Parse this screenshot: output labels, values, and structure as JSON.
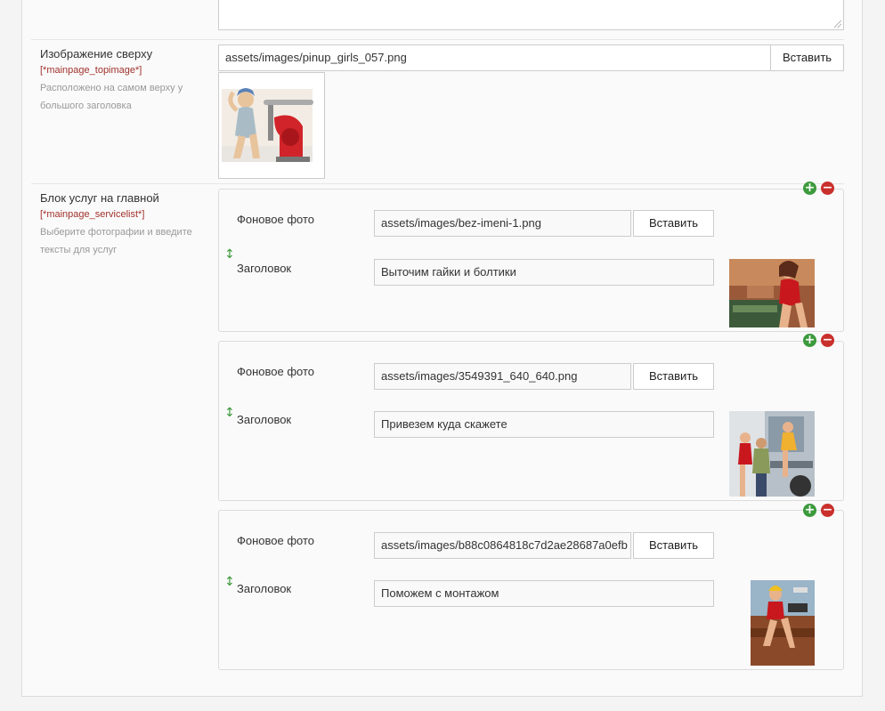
{
  "top_image_field": {
    "title": "Изображение сверху",
    "code": "[*mainpage_topimage*]",
    "description_line1": "Расположено на самом верху у",
    "description_line2": "большого заголовка",
    "value": "assets/images/pinup_girls_057.png",
    "insert_label": "Вставить"
  },
  "service_field": {
    "title": "Блок услуг на главной",
    "code": "[*mainpage_servicelist*]",
    "description_line1": "Выберите фотографии и введите",
    "description_line2": "тексты для услуг",
    "items": [
      {
        "photo_label": "Фоновое фото",
        "photo_value": "assets/images/bez-imeni-1.png",
        "insert_label": "Вставить",
        "heading_label": "Заголовок",
        "heading_value": "Выточим гайки и болтики"
      },
      {
        "photo_label": "Фоновое фото",
        "photo_value": "assets/images/3549391_640_640.png",
        "insert_label": "Вставить",
        "heading_label": "Заголовок",
        "heading_value": "Привезем куда скажете"
      },
      {
        "photo_label": "Фоновое фото",
        "photo_value": "assets/images/b88c0864818c7d2ae28687a0efb",
        "insert_label": "Вставить",
        "heading_label": "Заголовок",
        "heading_value": "Поможем с монтажом"
      }
    ]
  },
  "icons": {
    "add": "plus-circle-icon",
    "remove": "minus-circle-icon",
    "drag": "vertical-arrows-icon"
  },
  "colors": {
    "add_green": "#3c9a3c",
    "remove_red": "#c9302c",
    "code_red": "#a0322c"
  }
}
